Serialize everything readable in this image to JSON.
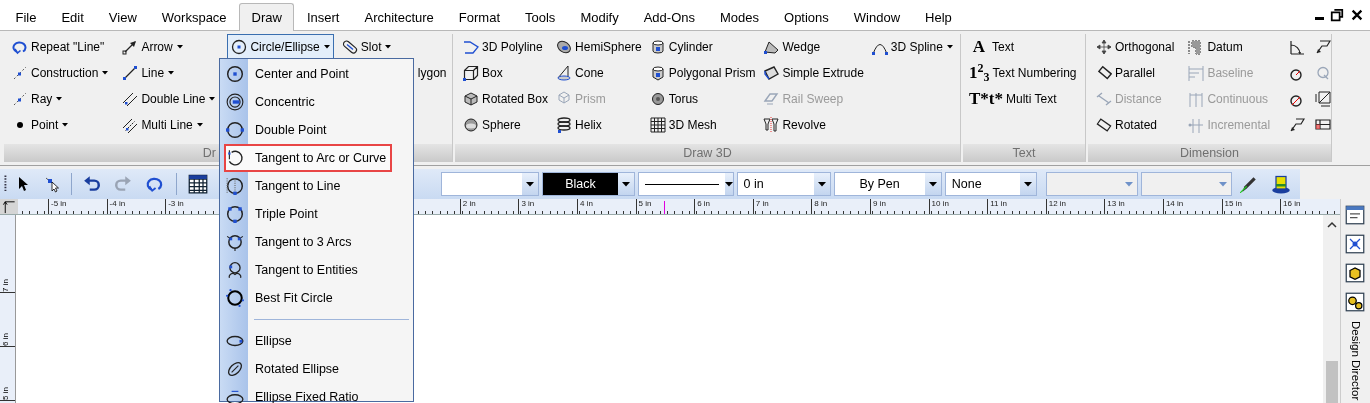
{
  "menu_bar": {
    "tabs": [
      {
        "label": "File",
        "selected": false
      },
      {
        "label": "Edit",
        "selected": false
      },
      {
        "label": "View",
        "selected": false
      },
      {
        "label": "Workspace",
        "selected": false
      },
      {
        "label": "Draw",
        "selected": true
      },
      {
        "label": "Insert",
        "selected": false
      },
      {
        "label": "Architecture",
        "selected": false
      },
      {
        "label": "Format",
        "selected": false
      },
      {
        "label": "Tools",
        "selected": false
      },
      {
        "label": "Modify",
        "selected": false
      },
      {
        "label": "Add-Ons",
        "selected": false
      },
      {
        "label": "Modes",
        "selected": false
      },
      {
        "label": "Options",
        "selected": false
      },
      {
        "label": "Window",
        "selected": false
      },
      {
        "label": "Help",
        "selected": false
      }
    ]
  },
  "ribbon": {
    "groups": [
      {
        "label": "Dr",
        "columns": [
          [
            {
              "label": "Repeat \"Line\"",
              "dropdown": false,
              "disabled": false,
              "pressed": false
            },
            {
              "label": "Construction",
              "dropdown": true,
              "disabled": false,
              "pressed": false
            },
            {
              "label": "Ray",
              "dropdown": true,
              "disabled": false,
              "pressed": false
            },
            {
              "label": "Point",
              "dropdown": true,
              "disabled": false,
              "pressed": false
            }
          ],
          [
            {
              "label": "Arrow",
              "dropdown": true,
              "disabled": false,
              "pressed": false
            },
            {
              "label": "Line",
              "dropdown": true,
              "disabled": false,
              "pressed": false
            },
            {
              "label": "Double Line",
              "dropdown": true,
              "disabled": false,
              "pressed": false
            },
            {
              "label": "Multi Line",
              "dropdown": true,
              "disabled": false,
              "pressed": false
            }
          ],
          [
            {
              "label": "Circle/Ellipse",
              "dropdown": true,
              "disabled": false,
              "pressed": true
            }
          ],
          [
            {
              "label": "Slot",
              "dropdown": true,
              "disabled": false,
              "pressed": false
            },
            {
              "label": "lygon",
              "dropdown": false,
              "disabled": false,
              "pressed": false
            }
          ]
        ]
      },
      {
        "label": "Draw 3D",
        "columns": [
          [
            {
              "label": "3D Polyline",
              "dropdown": false,
              "disabled": false,
              "pressed": false
            },
            {
              "label": "Box",
              "dropdown": false,
              "disabled": false,
              "pressed": false
            },
            {
              "label": "Rotated Box",
              "dropdown": false,
              "disabled": false,
              "pressed": false
            },
            {
              "label": "Sphere",
              "dropdown": false,
              "disabled": false,
              "pressed": false
            }
          ],
          [
            {
              "label": "HemiSphere",
              "dropdown": false,
              "disabled": false,
              "pressed": false
            },
            {
              "label": "Cone",
              "dropdown": false,
              "disabled": false,
              "pressed": false
            },
            {
              "label": "Prism",
              "dropdown": false,
              "disabled": true,
              "pressed": false
            },
            {
              "label": "Helix",
              "dropdown": false,
              "disabled": false,
              "pressed": false
            }
          ],
          [
            {
              "label": "Cylinder",
              "dropdown": false,
              "disabled": false,
              "pressed": false
            },
            {
              "label": "Polygonal Prism",
              "dropdown": false,
              "disabled": false,
              "pressed": false
            },
            {
              "label": "Torus",
              "dropdown": false,
              "disabled": false,
              "pressed": false
            },
            {
              "label": "3D Mesh",
              "dropdown": false,
              "disabled": false,
              "pressed": false
            }
          ],
          [
            {
              "label": "Wedge",
              "dropdown": false,
              "disabled": false,
              "pressed": false
            },
            {
              "label": "Simple Extrude",
              "dropdown": false,
              "disabled": false,
              "pressed": false
            },
            {
              "label": "Rail Sweep",
              "dropdown": false,
              "disabled": true,
              "pressed": false
            },
            {
              "label": "Revolve",
              "dropdown": false,
              "disabled": false,
              "pressed": false
            }
          ],
          [
            {
              "label": "3D Spline",
              "dropdown": true,
              "disabled": false,
              "pressed": false
            }
          ]
        ]
      },
      {
        "columns": [
          [
            {
              "label": "Text",
              "glyph": "A",
              "dropdown": false,
              "disabled": false,
              "pressed": false
            },
            {
              "label": "Text Numbering",
              "glyph": "1$^{2}$$_{3}$",
              "dropdown": false,
              "disabled": false,
              "pressed": false
            },
            {
              "label": "Multi Text",
              "glyph": "T*t*",
              "dropdown": false,
              "disabled": false,
              "pressed": false
            }
          ]
        ],
        "label": "Text"
      },
      {
        "label": "Dimension",
        "columns": [
          [
            {
              "label": "Orthogonal",
              "dropdown": false,
              "disabled": false,
              "pressed": false
            },
            {
              "label": "Parallel",
              "dropdown": false,
              "disabled": false,
              "pressed": false
            },
            {
              "label": "Distance",
              "dropdown": false,
              "disabled": true,
              "pressed": false
            },
            {
              "label": "Rotated",
              "dropdown": false,
              "disabled": false,
              "pressed": false
            }
          ],
          [
            {
              "label": "Datum",
              "dropdown": false,
              "disabled": false,
              "pressed": false
            },
            {
              "label": "Baseline",
              "dropdown": false,
              "disabled": true,
              "pressed": false
            },
            {
              "label": "Continuous",
              "dropdown": false,
              "disabled": true,
              "pressed": false
            },
            {
              "label": "Incremental",
              "dropdown": false,
              "disabled": true,
              "pressed": false
            }
          ]
        ],
        "icon_tools": [
          {
            "disabled": false
          },
          {
            "disabled": false
          },
          {
            "disabled": false
          },
          {
            "disabled": true
          },
          {
            "disabled": false
          },
          {
            "disabled": false
          },
          {
            "disabled": false
          },
          {
            "disabled": false
          }
        ]
      }
    ]
  },
  "toolbar": {
    "combos": [
      {
        "kind": "blank"
      },
      {
        "kind": "swatch",
        "value": "Black",
        "color": "#000000"
      },
      {
        "kind": "linestyle"
      },
      {
        "kind": "text",
        "value": "0 in"
      },
      {
        "kind": "centered",
        "value": "By Pen"
      },
      {
        "kind": "text",
        "value": "None"
      },
      {
        "kind": "flat"
      },
      {
        "kind": "flat"
      }
    ]
  },
  "ruler": {
    "left_labels": [
      "-5 in",
      "-4 in",
      "-3 in"
    ],
    "right_labels": [
      "2 in",
      "3 in",
      "4 in",
      "5 in",
      "6 in",
      "7 in",
      "8 in",
      "9 in",
      "10 in",
      "11 in",
      "12 in",
      "13 in",
      "14 in",
      "15 in",
      "16 in"
    ],
    "vertical_labels": [
      "7 in",
      "6 in",
      "5 in"
    ]
  },
  "side_panel": {
    "title": "Design Director"
  },
  "circle_menu": {
    "sections": [
      [
        {
          "label": "Center and Point",
          "highlighted": false
        },
        {
          "label": "Concentric",
          "highlighted": false
        },
        {
          "label": "Double Point",
          "highlighted": false
        },
        {
          "label": "Tangent to Arc or Curve",
          "highlighted": true
        },
        {
          "label": "Tangent to Line",
          "highlighted": false
        },
        {
          "label": "Triple Point",
          "highlighted": false
        },
        {
          "label": "Tangent to 3 Arcs",
          "highlighted": false
        },
        {
          "label": "Tangent to Entities",
          "highlighted": false
        },
        {
          "label": "Best Fit Circle",
          "highlighted": false
        }
      ],
      [
        {
          "label": "Ellipse",
          "highlighted": false
        },
        {
          "label": "Rotated Ellipse",
          "highlighted": false
        },
        {
          "label": "Ellipse Fixed Ratio",
          "highlighted": false
        }
      ]
    ]
  }
}
